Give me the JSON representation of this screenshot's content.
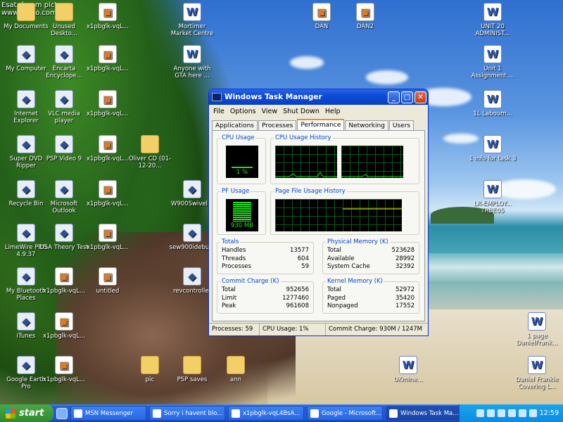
{
  "watermark": {
    "line1": "Esatoforum picture",
    "line2": "www.esato.com"
  },
  "desktop_icons": [
    {
      "label": "My Documents",
      "kind": "folder"
    },
    {
      "label": "Unused Deskto...",
      "kind": "folder"
    },
    {
      "label": "x1pbglk-vqL...",
      "kind": "img"
    },
    {
      "label": "Mortimer Market Centre",
      "kind": "word"
    },
    {
      "label": "DAN",
      "kind": "img"
    },
    {
      "label": "DAN2",
      "kind": "img"
    },
    {
      "label": "UNIT 20 ADMINIST...",
      "kind": "word"
    },
    {
      "label": "My Computer",
      "kind": "app"
    },
    {
      "label": "Encarta Encyclope...",
      "kind": "app"
    },
    {
      "label": "x1pbglk-vqL...",
      "kind": "img"
    },
    {
      "label": "Anyone with GTA here ...",
      "kind": "word"
    },
    {
      "label": "Unit 1 Assignment ...",
      "kind": "word"
    },
    {
      "label": "Internet Explorer",
      "kind": "app"
    },
    {
      "label": "VLC media player",
      "kind": "app"
    },
    {
      "label": "x1pbglk-vqL...",
      "kind": "img"
    },
    {
      "label": "1L Laboum...",
      "kind": "word"
    },
    {
      "label": "Super DVD Ripper",
      "kind": "app"
    },
    {
      "label": "PSP Video 9",
      "kind": "app"
    },
    {
      "label": "x1pbglk-vqL...",
      "kind": "img"
    },
    {
      "label": "Oliver CD (01-12-20...",
      "kind": "folder"
    },
    {
      "label": "1 info for task 3",
      "kind": "word"
    },
    {
      "label": "Recycle Bin",
      "kind": "app"
    },
    {
      "label": "Microsoft Outlook",
      "kind": "app"
    },
    {
      "label": "x1pbglk-vqL...",
      "kind": "img"
    },
    {
      "label": "W900Swivel...",
      "kind": "app"
    },
    {
      "label": "LR-EMPLOY... TRBE05",
      "kind": "word"
    },
    {
      "label": "LimeWire PRO 4.9.37",
      "kind": "app"
    },
    {
      "label": "DSA Theory Test",
      "kind": "app"
    },
    {
      "label": "x1pbglk-vqL...",
      "kind": "img"
    },
    {
      "label": "sew900idebu...",
      "kind": "app"
    },
    {
      "label": "My Bluetooth Places",
      "kind": "app"
    },
    {
      "label": "x1pbglk-vqL...",
      "kind": "img"
    },
    {
      "label": "untitled",
      "kind": "img"
    },
    {
      "label": "revcontroller",
      "kind": "app"
    },
    {
      "label": "iTunes",
      "kind": "app"
    },
    {
      "label": "x1pbglk-vqL...",
      "kind": "img"
    },
    {
      "label": "1 page DanielFrank...",
      "kind": "word"
    },
    {
      "label": "Google Earth Pro",
      "kind": "app"
    },
    {
      "label": "x1pbglk-vqL...",
      "kind": "img"
    },
    {
      "label": "pic",
      "kind": "folder"
    },
    {
      "label": "PSP saves",
      "kind": "folder"
    },
    {
      "label": "ann",
      "kind": "folder"
    },
    {
      "label": "UKmine...",
      "kind": "word"
    },
    {
      "label": "Daniel Frankie Covering L...",
      "kind": "word"
    }
  ],
  "task_manager": {
    "title": "Windows Task Manager",
    "menu": [
      "File",
      "Options",
      "View",
      "Shut Down",
      "Help"
    ],
    "tabs": [
      {
        "label": "Applications",
        "active": false
      },
      {
        "label": "Processes",
        "active": false
      },
      {
        "label": "Performance",
        "active": true
      },
      {
        "label": "Networking",
        "active": false
      },
      {
        "label": "Users",
        "active": false
      }
    ],
    "cpu_usage": {
      "label": "CPU Usage",
      "value": "1 %",
      "level": 0.01
    },
    "cpu_history": {
      "label": "CPU Usage History"
    },
    "pf_usage": {
      "label": "PF Usage",
      "value": "930 MB"
    },
    "pf_history": {
      "label": "Page File Usage History"
    },
    "totals": {
      "label": "Totals",
      "rows": [
        {
          "k": "Handles",
          "v": "13577"
        },
        {
          "k": "Threads",
          "v": "604"
        },
        {
          "k": "Processes",
          "v": "59"
        }
      ]
    },
    "physical": {
      "label": "Physical Memory (K)",
      "rows": [
        {
          "k": "Total",
          "v": "523628"
        },
        {
          "k": "Available",
          "v": "28992"
        },
        {
          "k": "System Cache",
          "v": "32392"
        }
      ]
    },
    "commit": {
      "label": "Commit Charge (K)",
      "rows": [
        {
          "k": "Total",
          "v": "952656"
        },
        {
          "k": "Limit",
          "v": "1277460"
        },
        {
          "k": "Peak",
          "v": "961608"
        }
      ]
    },
    "kernel": {
      "label": "Kernel Memory (K)",
      "rows": [
        {
          "k": "Total",
          "v": "52972"
        },
        {
          "k": "Paged",
          "v": "35420"
        },
        {
          "k": "Nonpaged",
          "v": "17552"
        }
      ]
    },
    "status": {
      "processes": "Processes: 59",
      "cpu": "CPU Usage: 1%",
      "commit": "Commit Charge: 930M / 1247M"
    }
  },
  "taskbar": {
    "start_label": "start",
    "buttons": [
      {
        "label": "MSN Messenger",
        "active": false
      },
      {
        "label": "Sorry i havent blo...",
        "active": false
      },
      {
        "label": "x1pbglk-vqL4BsA...",
        "active": false
      },
      {
        "label": "Google - Microsoft...",
        "active": false
      },
      {
        "label": "Windows Task Ma...",
        "active": true
      }
    ],
    "clock": "12:59"
  }
}
